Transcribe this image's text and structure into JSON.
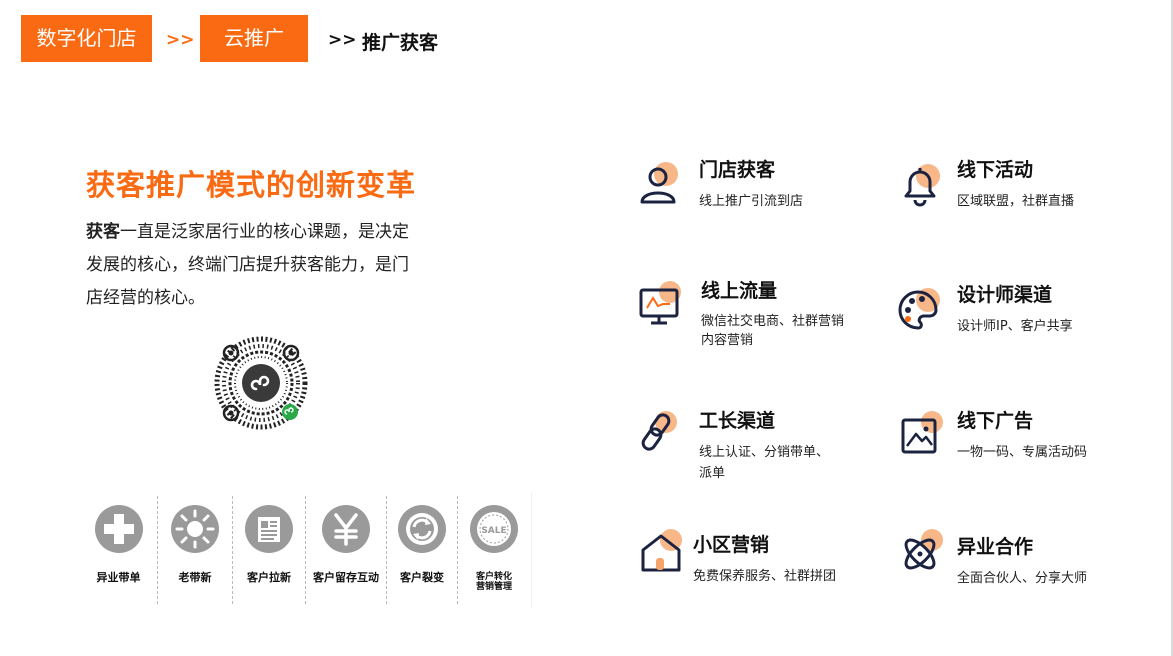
{
  "breadcrumb": {
    "item1": "数字化门店",
    "sep1": ">>",
    "item2": "云推广",
    "sep2": ">>",
    "current": "推广获客"
  },
  "main": {
    "title": "获客推广模式的创新变革",
    "desc_bold": "获客",
    "desc_line1": "一直是泛家居行业的核心课题，是决定",
    "desc_line2": "发展的核心，终端门店提升获客能力，是门",
    "desc_line3": "店经营的核心。"
  },
  "strip": {
    "items": [
      {
        "label": "异业带单",
        "icon": "plus-icon"
      },
      {
        "label": "老带新",
        "icon": "sun-icon"
      },
      {
        "label": "客户拉新",
        "icon": "newspaper-icon"
      },
      {
        "label": "客户留存互动",
        "icon": "yen-icon"
      },
      {
        "label": "客户裂变",
        "icon": "refresh-icon"
      },
      {
        "label_line1": "客户转化",
        "label_line2": "营销管理",
        "icon": "sale-badge-icon",
        "badge_text": "SALE"
      }
    ]
  },
  "features": [
    {
      "title": "门店获客",
      "desc1": "线上推广引流到店",
      "desc2": "",
      "icon": "user-icon"
    },
    {
      "title": "线下活动",
      "desc1": "区域联盟，社群直播",
      "desc2": "",
      "icon": "bell-icon"
    },
    {
      "title": "线上流量",
      "desc1": "微信社交电商、社群营销",
      "desc2": "内容营销",
      "icon": "monitor-icon"
    },
    {
      "title": "设计师渠道",
      "desc1": "设计师IP、客户共享",
      "desc2": "",
      "icon": "palette-icon"
    },
    {
      "title": "工长渠道",
      "desc1": "线上认证、分销带单、",
      "desc2": "派单",
      "icon": "link-icon"
    },
    {
      "title": "线下广告",
      "desc1": "一物一码、专属活动码",
      "desc2": "",
      "icon": "image-icon"
    },
    {
      "title": "小区营销",
      "desc1": "免费保养服务、社群拼团",
      "desc2": "",
      "icon": "home-icon"
    },
    {
      "title": "异业合作",
      "desc1": "全面合伙人、分享大师",
      "desc2": "",
      "icon": "atom-icon"
    }
  ],
  "colors": {
    "accent": "#f96a12",
    "icon_dark": "#1c2340",
    "icon_glow": "#f6a56a",
    "strip_gray": "#9a9a9a"
  }
}
